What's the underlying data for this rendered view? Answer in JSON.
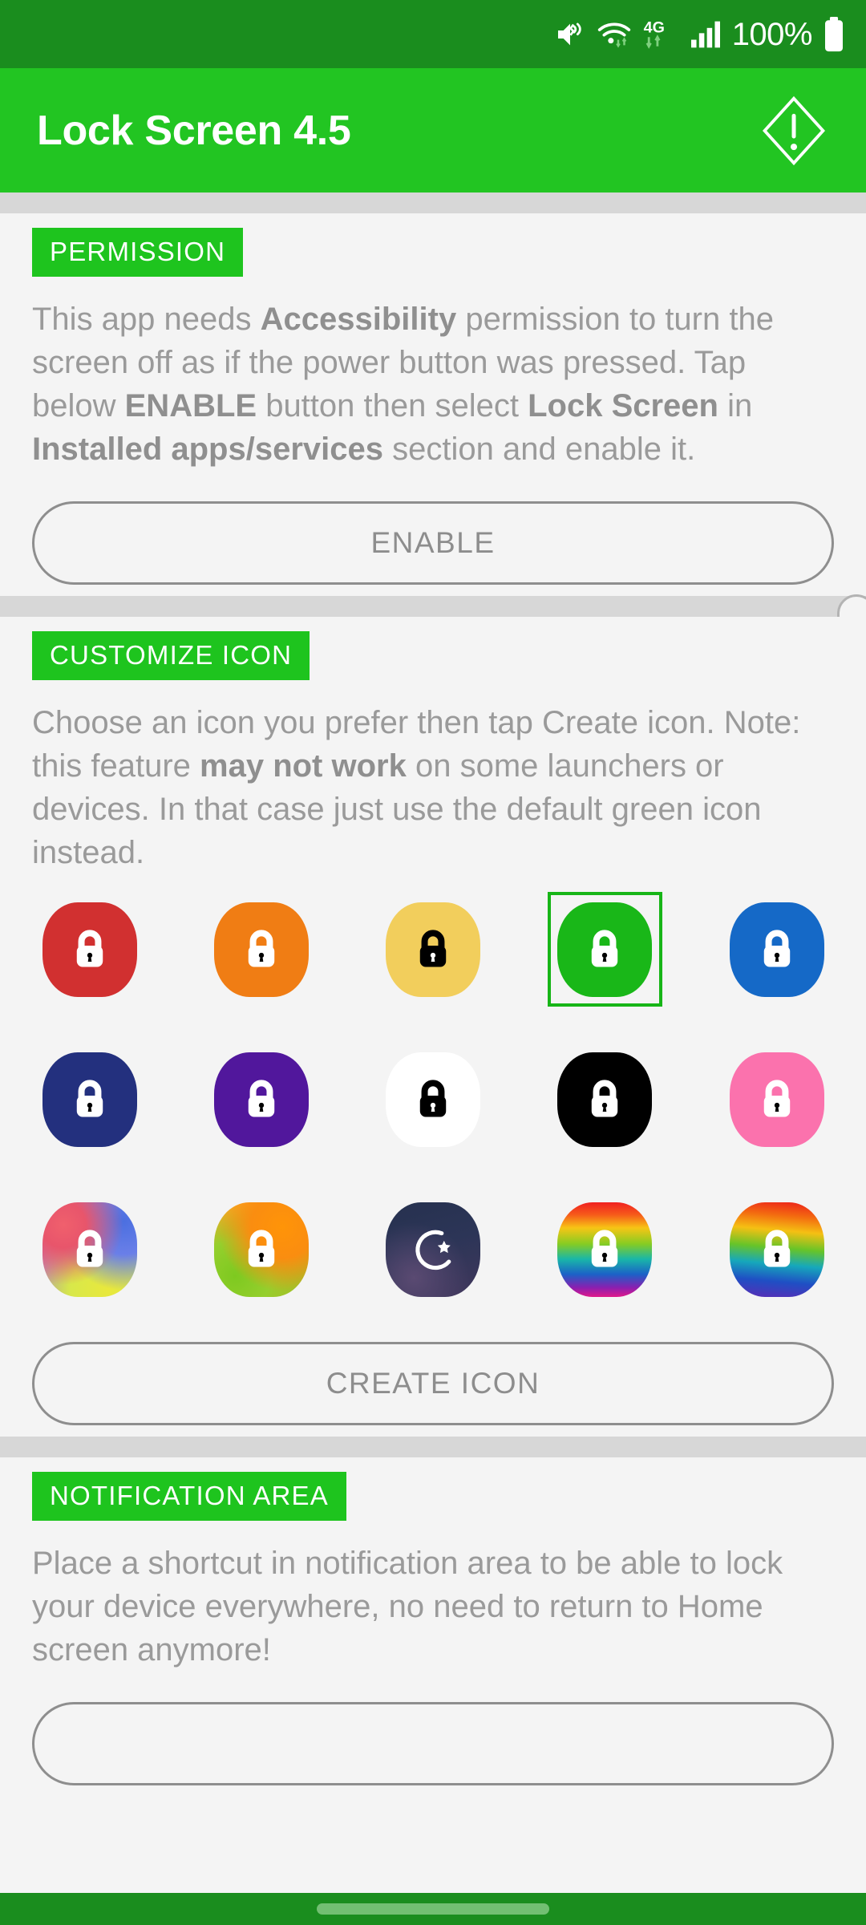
{
  "status_bar": {
    "battery_percent": "100%",
    "icons": [
      "mute-vibrate-icon",
      "wifi-icon",
      "network-4g-icon",
      "signal-bars-icon",
      "battery-icon"
    ],
    "network_type": "4G",
    "background": "#1a8d1e"
  },
  "app_bar": {
    "title": "Lock Screen 4.5",
    "action_icon": "warning-rhombus-icon",
    "background": "#22c522"
  },
  "sections": {
    "permission": {
      "tag": "PERMISSION",
      "text_parts": [
        {
          "t": "This app needs ",
          "b": false
        },
        {
          "t": "Accessibility",
          "b": true
        },
        {
          "t": " permission to turn the screen off as if the power button was pressed. Tap below ",
          "b": false
        },
        {
          "t": "ENABLE",
          "b": true
        },
        {
          "t": " button then select ",
          "b": false
        },
        {
          "t": "Lock Screen",
          "b": true
        },
        {
          "t": " in ",
          "b": false
        },
        {
          "t": "Installed apps/services",
          "b": true
        },
        {
          "t": " section and enable it.",
          "b": false
        }
      ],
      "button_label": "ENABLE"
    },
    "customize_icon": {
      "tag": "CUSTOMIZE ICON",
      "text_parts": [
        {
          "t": "Choose an icon you prefer then tap Create icon. Note: this feature ",
          "b": false
        },
        {
          "t": "may not work",
          "b": true
        },
        {
          "t": " on some launchers or devices. In that case just use the default green icon instead.",
          "b": false
        }
      ],
      "button_label": "CREATE ICON",
      "selected_index": 3,
      "icons": [
        {
          "name": "lock-icon-red",
          "fill": "#d13030",
          "lock": "#ffffff",
          "style": "solid"
        },
        {
          "name": "lock-icon-orange",
          "fill": "#f07d14",
          "lock": "#ffffff",
          "style": "solid"
        },
        {
          "name": "lock-icon-yellow",
          "fill": "#f2ce5c",
          "lock": "#000000",
          "style": "solid"
        },
        {
          "name": "lock-icon-green",
          "fill": "#19b718",
          "lock": "#ffffff",
          "style": "solid"
        },
        {
          "name": "lock-icon-blue",
          "fill": "#1569c7",
          "lock": "#ffffff",
          "style": "solid"
        },
        {
          "name": "lock-icon-navy",
          "fill": "#23307e",
          "lock": "#ffffff",
          "style": "solid"
        },
        {
          "name": "lock-icon-purple",
          "fill": "#51179c",
          "lock": "#ffffff",
          "style": "solid"
        },
        {
          "name": "lock-icon-white",
          "fill": "#ffffff",
          "lock": "#000000",
          "style": "solid"
        },
        {
          "name": "lock-icon-black",
          "fill": "#000000",
          "lock": "#ffffff",
          "style": "solid"
        },
        {
          "name": "lock-icon-pink",
          "fill": "#fb72ad",
          "lock": "#ffffff",
          "style": "solid"
        },
        {
          "name": "lock-icon-gradient-pastel",
          "fill": "",
          "lock": "#ffffff",
          "style": "grad-pastel"
        },
        {
          "name": "lock-icon-gradient-warm",
          "fill": "",
          "lock": "#ffffff",
          "style": "grad-warm"
        },
        {
          "name": "moon-star-icon-night",
          "fill": "",
          "lock": "#ffffff",
          "style": "night"
        },
        {
          "name": "lock-icon-tiedye-rainbow",
          "fill": "",
          "lock": "#ffffff",
          "style": "grad-tiedye"
        },
        {
          "name": "lock-icon-rainbow",
          "fill": "",
          "lock": "#ffffff",
          "style": "grad-rainbow"
        }
      ]
    },
    "notification_area": {
      "tag": "NOTIFICATION AREA",
      "text_parts": [
        {
          "t": "Place a shortcut in notification area to be able to lock your device everywhere, no need to return to Home screen anymore!",
          "b": false
        }
      ]
    }
  },
  "nav_bar": {
    "gesture_pill": "home-gesture-pill",
    "background": "#1a8d1e"
  }
}
